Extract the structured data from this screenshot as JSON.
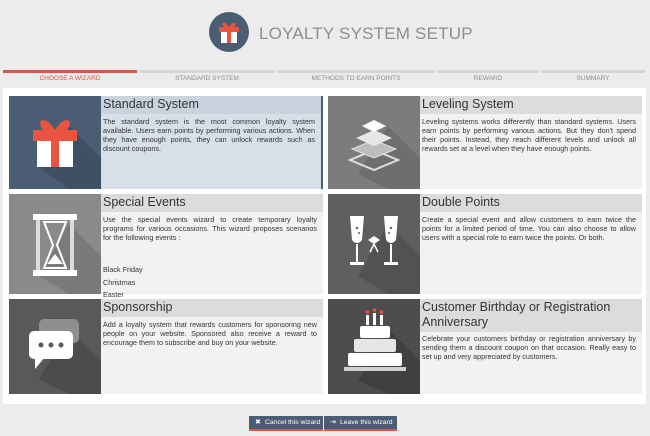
{
  "app": {
    "title": "LOYALTY SYSTEM SETUP",
    "logo_icon": "gift-icon",
    "accent_color": "#d9534f",
    "brand_color": "#4a5d73"
  },
  "wizard_steps": [
    {
      "label": "CHOOSE A WIZARD",
      "active": true
    },
    {
      "label": "STANDARD SYSTEM",
      "active": false
    },
    {
      "label": "METHODS TO EARN POINTS",
      "active": false
    },
    {
      "label": "REWARD",
      "active": false
    },
    {
      "label": "SUMMARY",
      "active": false
    }
  ],
  "wizards": [
    {
      "title": "Standard System",
      "icon": "gift-box-icon",
      "description": "The standard system is the most common loyalty system available. Users earn points by performing various actions. When they have enough points, they can unlock rewards such as discount coupons."
    },
    {
      "title": "Leveling System",
      "icon": "layers-icon",
      "description": "Leveling systems works differently than standard systems. Users earn points by performing various actions. But they don't spend their points. Instead, they reach different levels and unlock all rewards set at a level when they have enough points."
    },
    {
      "title": "Special Events",
      "icon": "hourglass-icon",
      "description": "Use the special events wizard to create temporary loyalty programs for various occasions. This wizard proposes scenarios for the following events :",
      "events": [
        "Black Friday",
        "Christmas",
        "Easter"
      ]
    },
    {
      "title": "Double Points",
      "icon": "champagne-glasses-icon",
      "description": "Create a special event and allow customers to earn twice the points for a limited period of time. You can also choose to allow users with a special role to earn twice the points. Or both."
    },
    {
      "title": "Sponsorship",
      "icon": "chat-bubbles-icon",
      "description": "Add a loyalty system that rewards customers for sponsoring new people on your website. Sponsored also receive a reward to encourage them to subscribe and buy on your website."
    },
    {
      "title": "Customer Birthday or Registration Anniversary",
      "icon": "birthday-cake-icon",
      "description": "Celebrate your customers birthday or registration anniversary by sending them a discount coupon on that occasion. Really easy to set up and very appreciated by customers."
    }
  ],
  "footer": {
    "cancel_label": "Cancel this wizard",
    "leave_label": "Leave this wizard"
  }
}
